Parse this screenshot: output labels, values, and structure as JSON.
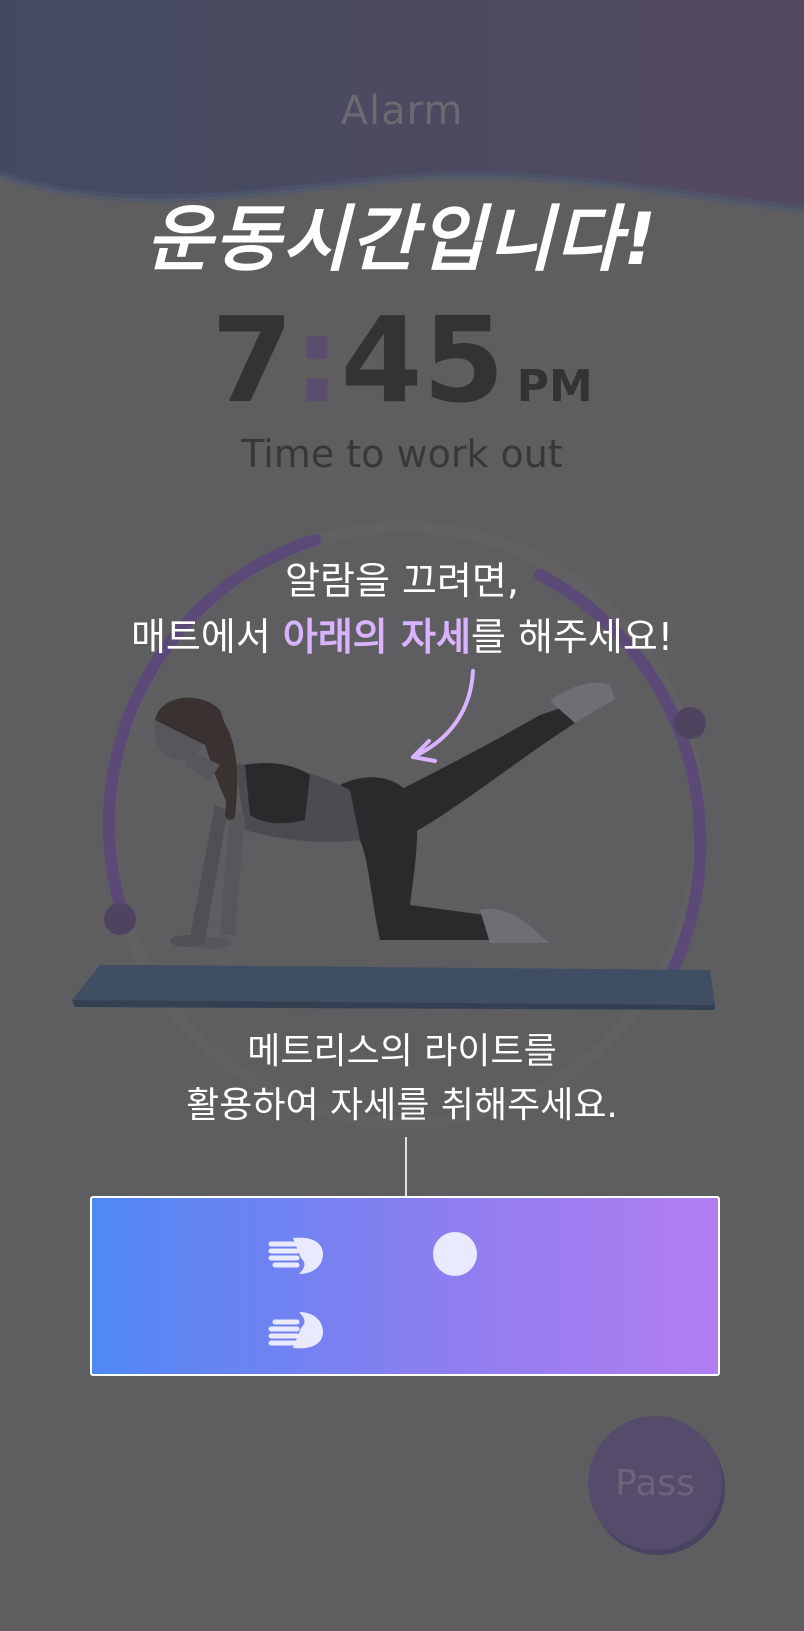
{
  "header": {
    "title": "Alarm"
  },
  "headline": "운동시간입니다!",
  "clock": {
    "hour": "7",
    "separator": ":",
    "minutes": "45",
    "ampm": "PM"
  },
  "subtitle": "Time to work out",
  "instruction": {
    "line1": "알람을 끄려면,",
    "line2_before": "매트에서 ",
    "line2_highlight": "아래의 자세",
    "line2_after": "를 해주세요!"
  },
  "note": {
    "line1": "메트리스의 라이트를",
    "line2": "활용하여 자세를 취해주세요."
  },
  "mat_panel": {
    "icons": [
      "hand-icon",
      "hand-icon",
      "light-dot"
    ]
  },
  "pass_button": {
    "label": "Pass"
  },
  "colors": {
    "background": "#5e5e60",
    "accent_highlight": "#d9b3ff",
    "panel_gradient_start": "#4e88f4",
    "panel_gradient_end": "#b27ef2",
    "ring": "#5b4a78"
  }
}
